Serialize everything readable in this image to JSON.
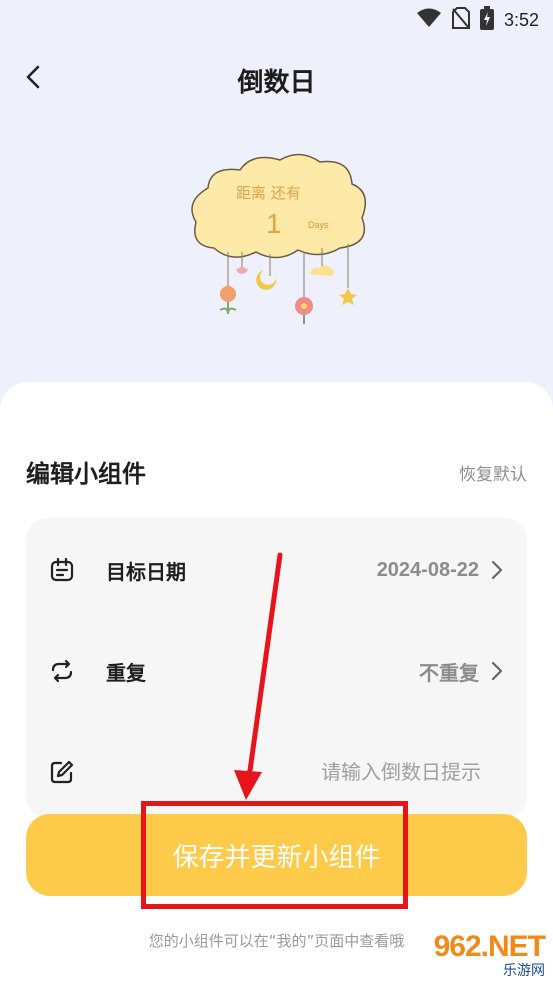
{
  "status_bar": {
    "time": "3:52",
    "icons": [
      "wifi-icon",
      "no-sim-icon",
      "battery-charging-icon"
    ]
  },
  "header": {
    "title": "倒数日",
    "back_icon": "chevron-left-icon"
  },
  "preview": {
    "label": "距离 还有",
    "number": "1",
    "unit": "Days"
  },
  "editor": {
    "title": "编辑小组件",
    "restore_label": "恢复默认",
    "rows": [
      {
        "icon": "calendar-icon",
        "label": "目标日期",
        "value": "2024-08-22"
      },
      {
        "icon": "repeat-icon",
        "label": "重复",
        "value": "不重复"
      },
      {
        "icon": "edit-icon",
        "placeholder": "请输入倒数日提示",
        "value": ""
      }
    ],
    "save_label": "保存并更新小组件",
    "hint": "您的小组件可以在“我的”页面中查看哦"
  },
  "colors": {
    "background": "#eef1fb",
    "accent": "#fdca4a",
    "annotation": "#e8141c"
  },
  "watermark": {
    "main": "962.NET",
    "sub": "乐游网"
  }
}
